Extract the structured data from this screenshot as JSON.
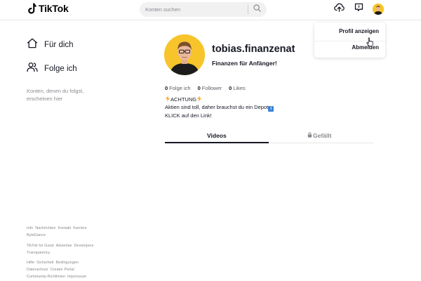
{
  "header": {
    "logo_text": "TikTok",
    "search_placeholder": "Konten suchen"
  },
  "profile_menu": {
    "items": [
      "Profil anzeigen",
      "Abmelden"
    ]
  },
  "sidebar": {
    "nav": [
      {
        "label": "Für dich",
        "icon": "home-icon"
      },
      {
        "label": "Folge ich",
        "icon": "users-icon"
      }
    ],
    "follow_hint": "Konten, denen du folgst, erscheinen hier",
    "footer": {
      "group1": [
        "Info",
        "Nachrichten",
        "Kontakt",
        "Karriere",
        "ByteDance"
      ],
      "group2": [
        "TikTok for Good",
        "Advertise",
        "Developers",
        "Transparency"
      ],
      "group3": [
        "Hilfe",
        "Sicherheit",
        "Bedingungen",
        "Datenschutz",
        "Creator Portal",
        "Community-Richtlinien",
        "Impressum"
      ]
    }
  },
  "profile": {
    "username": "tobias.finanzenat",
    "display_name": "Finanzen für Anfänger!",
    "stats": {
      "following_count": "0",
      "following_label": "Folge ich",
      "followers_count": "0",
      "followers_label": "Follower",
      "likes_count": "0",
      "likes_label": "Likes"
    },
    "bio": {
      "line1": "ACHTUNG",
      "line2": "Aktien sind toll, daher brauchst du ein Depot",
      "line3": "KLICK auf den Link!",
      "info_glyph": "i"
    }
  },
  "tabs": {
    "videos": "Videos",
    "liked": "Gefällt"
  },
  "colors": {
    "avatar_bg": "#f7c52b",
    "text_primary": "#161823",
    "text_secondary": "#8a8b91",
    "bolt_emoji": "#f5a623"
  }
}
